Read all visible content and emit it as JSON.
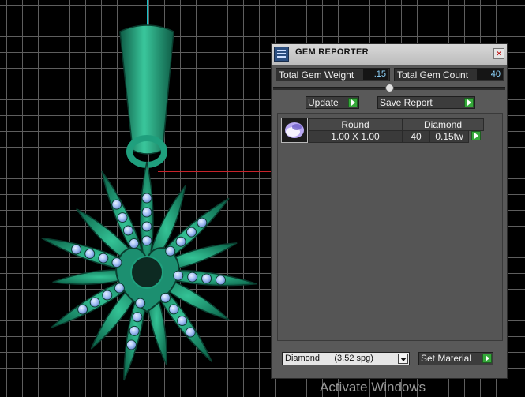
{
  "panel": {
    "title": "GEM REPORTER",
    "close_symbol": "×",
    "app_icon": "gem-reporter-icon",
    "totals": {
      "weight_label": "Total Gem Weight",
      "weight_value": ".15",
      "count_label": "Total Gem Count",
      "count_value": "40"
    },
    "slider_position": 0.5,
    "buttons": {
      "update": "Update",
      "save_report": "Save Report",
      "set_material": "Set Material"
    },
    "gem_table": {
      "headers": [
        "Round",
        "Diamond"
      ],
      "rows": [
        {
          "size": "1.00 X 1.00",
          "count": "40",
          "weight": "0.15tw"
        }
      ]
    },
    "material_select": {
      "selected": "Diamond      (3.52 spg)"
    }
  },
  "colors": {
    "grid": "#5e5e5e",
    "metal": "#1f9f7d",
    "gem": "#8fb2f2",
    "y_axis": "#19c1c9",
    "x_axis": "#c8232a",
    "go_button": "#35a83a"
  },
  "watermark": "Activate Windows"
}
